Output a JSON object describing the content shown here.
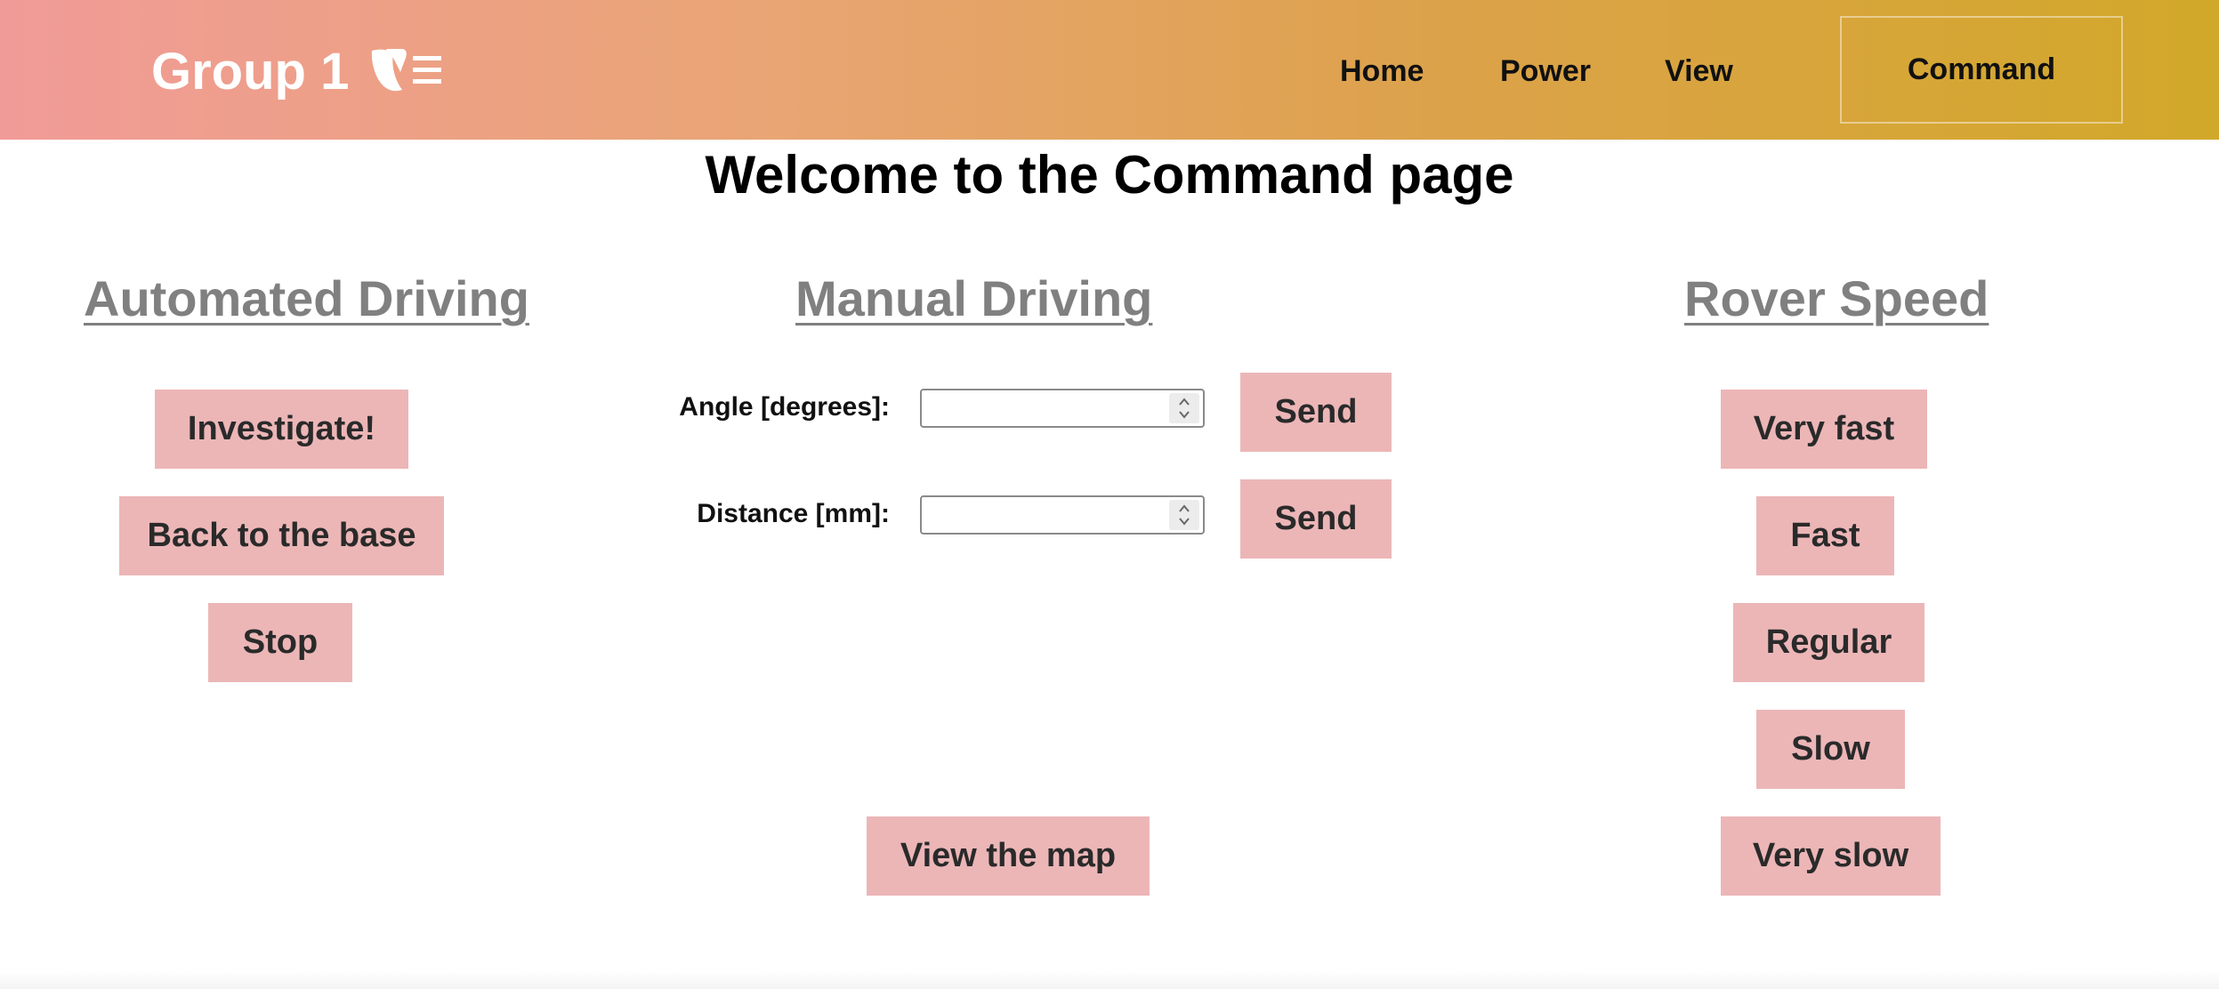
{
  "header": {
    "brand": "Group 1",
    "logo_icon": "typo3-logo-icon",
    "nav": {
      "home": "Home",
      "power": "Power",
      "view": "View",
      "command": "Command"
    }
  },
  "main": {
    "title": "Welcome to the Command page",
    "automated": {
      "heading": "Automated Driving",
      "buttons": {
        "investigate": "Investigate!",
        "back_to_base": "Back to the base",
        "stop": "Stop"
      }
    },
    "manual": {
      "heading": "Manual Driving",
      "angle_label": "Angle [degrees]:",
      "angle_value": "",
      "distance_label": "Distance [mm]:",
      "distance_value": "",
      "send_label": "Send",
      "view_map_label": "View the map"
    },
    "speed": {
      "heading": "Rover Speed",
      "buttons": {
        "very_fast": "Very fast",
        "fast": "Fast",
        "regular": "Regular",
        "slow": "Slow",
        "very_slow": "Very slow"
      }
    }
  },
  "colors": {
    "header_gradient_start": "#f19b98",
    "header_gradient_end": "#d2a82a",
    "button_background": "#ecb6b7",
    "heading_gray": "#808080"
  }
}
